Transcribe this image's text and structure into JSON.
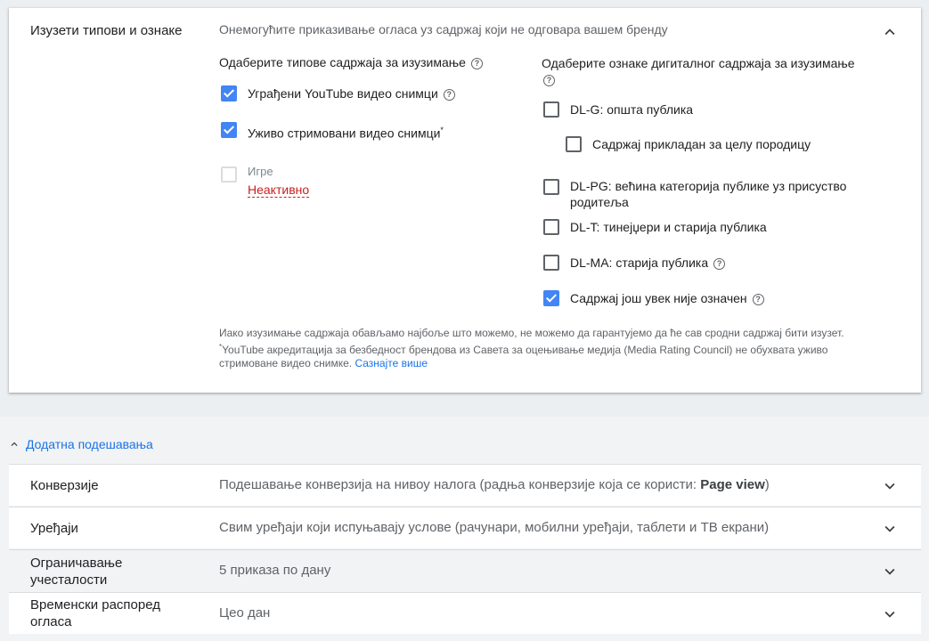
{
  "exclusion": {
    "title": "Изузети типови и ознаке",
    "description": "Онемогућите приказивање огласа уз садржај који не одговара вашем бренду",
    "content_types_heading": "Одаберите типове садржаја за изузимање",
    "content_types": [
      {
        "label": "Уграђени YouTube видео снимци",
        "checked": true,
        "help": true
      },
      {
        "label": "Уживо стримовани видео снимци",
        "checked": true,
        "asterisk": "*"
      },
      {
        "label": "Игре",
        "checked": false,
        "disabled": true,
        "status": "Неактивно"
      }
    ],
    "labels_heading": "Одаберите ознаке дигиталног садржаја за изузимање",
    "labels": [
      {
        "label": "DL-G: општа публика",
        "checked": false
      },
      {
        "label": "Садржај прикладан за целу породицу",
        "checked": false,
        "indent": true
      },
      {
        "label": "DL-PG: већина категорија публике уз присуство",
        "label_line2": "родитеља",
        "checked": false
      },
      {
        "label": "DL-T: тинејџери и старија публика",
        "checked": false
      },
      {
        "label": "DL-MA: старија публика",
        "checked": false,
        "help": true
      },
      {
        "label": "Садржај још увек није означен",
        "checked": true,
        "help": true
      }
    ],
    "note1": "Иако изузимање садржаја обављамо најбоље што можемо, не можемо да гарантујемо да ће сав сродни садржај бити изузет.",
    "note2_asterisk": "*",
    "note2": "YouTube акредитација за безбедност брендова из Савета за оцењивање медија (Media Rating Council) не обухвата уживо стримоване видео снимке.",
    "learn_more": "Сазнајте више"
  },
  "advanced": {
    "toggle_label": "Додатна подешавања",
    "rows": [
      {
        "label": "Конверзије",
        "value_prefix": "Подешавање конверзија на нивоу налога (радња конверзије која се користи: ",
        "value_bold": "Page view",
        "value_suffix": ")"
      },
      {
        "label": "Уређаји",
        "value": "Свим уређаји који испуњавају услове (рачунари, мобилни уређаји, таблети и ТВ екрани)"
      },
      {
        "label_line1": "Ограничавање",
        "label_line2": "учесталости",
        "value": "5 приказа по дану"
      },
      {
        "label_line1": "Временски распоред",
        "label_line2": "огласа",
        "value": "Цео дан"
      }
    ]
  },
  "icons": {
    "help": "help-circle-icon",
    "expand": "chevron-down-icon",
    "collapse": "chevron-up-icon"
  },
  "colors": {
    "accent": "#4285f4",
    "link": "#1a73e8",
    "error": "#c5221f"
  }
}
